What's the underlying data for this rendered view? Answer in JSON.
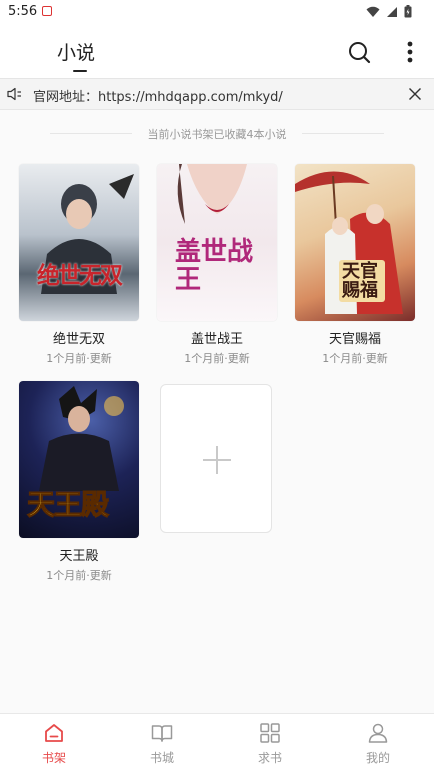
{
  "status_bar": {
    "time": "5:56"
  },
  "header": {
    "title": "小说"
  },
  "notice": {
    "text": "官网地址：https://mhdqapp.com/mkyd/"
  },
  "shelf": {
    "count_text": "当前小说书架已收藏4本小说",
    "books": [
      {
        "title": "绝世无双",
        "meta": "1个月前·更新",
        "cover_text": "绝世无双"
      },
      {
        "title": "盖世战王",
        "meta": "1个月前·更新",
        "cover_text": "盖世战王"
      },
      {
        "title": "天官赐福",
        "meta": "1个月前·更新",
        "cover_text": "天官赐福"
      },
      {
        "title": "天王殿",
        "meta": "1个月前·更新",
        "cover_text": "天王殿"
      }
    ]
  },
  "bottom_nav": [
    {
      "label": "书架",
      "icon": "bookshelf-icon",
      "active": true
    },
    {
      "label": "书城",
      "icon": "open-book-icon",
      "active": false
    },
    {
      "label": "求书",
      "icon": "grid-icon",
      "active": false
    },
    {
      "label": "我的",
      "icon": "person-icon",
      "active": false
    }
  ],
  "colors": {
    "accent": "#e74a4a",
    "muted": "#999999"
  }
}
